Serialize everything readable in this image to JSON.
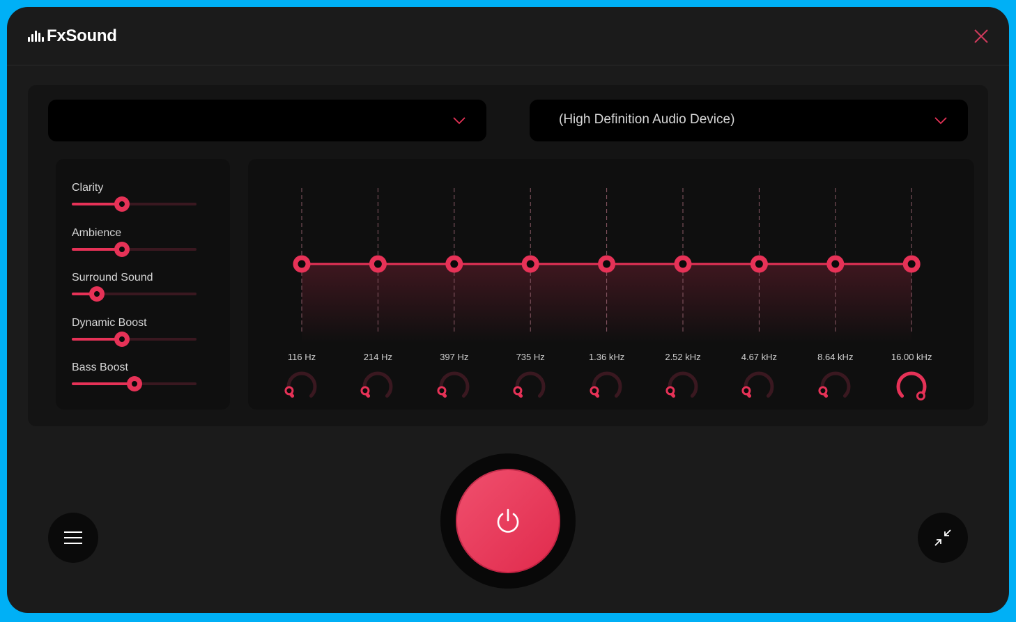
{
  "app": {
    "title": "FxSound",
    "logo_icon": "equalizer-bars-icon",
    "close_icon": "close-icon",
    "accent_color": "#e63257",
    "background_color": "#00b0f6"
  },
  "preset_dropdown": {
    "value": "",
    "icon": "chevron-down-icon"
  },
  "device_dropdown": {
    "value": "(High Definition Audio Device)",
    "icon": "chevron-down-icon"
  },
  "effects": [
    {
      "label": "Clarity",
      "value": 0.4
    },
    {
      "label": "Ambience",
      "value": 0.4
    },
    {
      "label": "Surround Sound",
      "value": 0.2
    },
    {
      "label": "Dynamic Boost",
      "value": 0.4
    },
    {
      "label": "Bass Boost",
      "value": 0.5
    }
  ],
  "equalizer": {
    "bands": [
      {
        "freq": "116 Hz",
        "gain": 0,
        "knob": 0.1
      },
      {
        "freq": "214 Hz",
        "gain": 0,
        "knob": 0.1
      },
      {
        "freq": "397 Hz",
        "gain": 0,
        "knob": 0.1
      },
      {
        "freq": "735 Hz",
        "gain": 0,
        "knob": 0.1
      },
      {
        "freq": "1.36 kHz",
        "gain": 0,
        "knob": 0.1
      },
      {
        "freq": "2.52 kHz",
        "gain": 0,
        "knob": 0.1
      },
      {
        "freq": "4.67 kHz",
        "gain": 0,
        "knob": 0.1
      },
      {
        "freq": "8.64 kHz",
        "gain": 0,
        "knob": 0.1
      },
      {
        "freq": "16.00 kHz",
        "gain": 0,
        "knob": 1.0
      }
    ],
    "gain_range": [
      -1,
      1
    ]
  },
  "controls": {
    "power_icon": "power-icon",
    "power_state": "on",
    "menu_icon": "hamburger-menu-icon",
    "shrink_icon": "minimize-arrows-icon"
  }
}
